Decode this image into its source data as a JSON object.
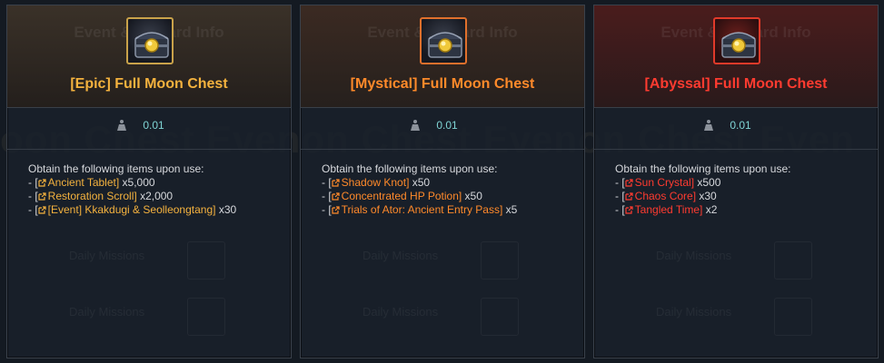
{
  "background_watermark": "oon Chest Evenon Chest Evenon Chest Even",
  "ghost_header": "Event & Reward Info",
  "ghost_row_label": "Daily Missions",
  "colors": {
    "epic": "#f4b23e",
    "mystical": "#ff8a2a",
    "abyssal": "#ff3b30",
    "weight": "#7fd4d4"
  },
  "cards": [
    {
      "title": "[Epic] Full Moon Chest",
      "icon": "chest-icon",
      "weight": "0.01",
      "desc_intro": "Obtain the following items upon use:",
      "items": [
        {
          "prefix": "- [",
          "name": "Ancient Tablet",
          "suffix": "]",
          "qty": " x5,000"
        },
        {
          "prefix": "- [",
          "name": "Restoration Scroll",
          "suffix": "]",
          "qty": " x2,000"
        },
        {
          "prefix": "- [",
          "name": "[Event] Kkakdugi & Seolleongtang",
          "suffix": "]",
          "qty": " x30"
        }
      ]
    },
    {
      "title": "[Mystical] Full Moon Chest",
      "icon": "chest-icon",
      "weight": "0.01",
      "desc_intro": "Obtain the following items upon use:",
      "items": [
        {
          "prefix": "- [",
          "name": "Shadow Knot",
          "suffix": "]",
          "qty": " x50"
        },
        {
          "prefix": "- [",
          "name": "Concentrated HP Potion",
          "suffix": "]",
          "qty": " x50"
        },
        {
          "prefix": "- [",
          "name": "Trials of Ator: Ancient Entry Pass",
          "suffix": "]",
          "qty": " x5"
        }
      ]
    },
    {
      "title": "[Abyssal] Full Moon Chest",
      "icon": "chest-icon",
      "weight": "0.01",
      "desc_intro": "Obtain the following items upon use:",
      "items": [
        {
          "prefix": "- [",
          "name": "Sun Crystal",
          "suffix": "]",
          "qty": " x500"
        },
        {
          "prefix": "- [",
          "name": "Chaos Core",
          "suffix": "]",
          "qty": " x30"
        },
        {
          "prefix": "- [",
          "name": "Tangled Time",
          "suffix": "]",
          "qty": " x2"
        }
      ]
    }
  ]
}
